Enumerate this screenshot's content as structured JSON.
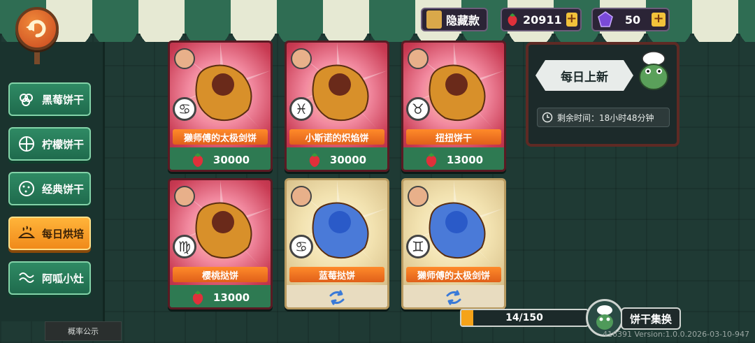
{
  "currency": {
    "hidden_label": "隐藏款",
    "strawberry_amount": "20911",
    "gem_amount": "50"
  },
  "sidebar": {
    "items": [
      {
        "label": "黑莓饼干"
      },
      {
        "label": "柠檬饼干"
      },
      {
        "label": "经典饼干"
      },
      {
        "label": "每日烘培"
      },
      {
        "label": "阿呱小灶"
      }
    ],
    "prob_label": "概率公示"
  },
  "cards": [
    {
      "name": "獭师傅的太极剑饼",
      "price": "30000",
      "zodiac": "♋",
      "style": "red"
    },
    {
      "name": "小斯诺的炽焰饼",
      "price": "30000",
      "zodiac": "♓",
      "style": "red"
    },
    {
      "name": "扭扭饼干",
      "price": "13000",
      "zodiac": "♉",
      "style": "red"
    },
    {
      "name": "樱桃挞饼",
      "price": "13000",
      "zodiac": "♍",
      "style": "red"
    },
    {
      "name": "蓝莓挞饼",
      "price": "",
      "zodiac": "♋",
      "style": "gold"
    },
    {
      "name": "獭师傅的太极剑饼",
      "price": "",
      "zodiac": "♊",
      "style": "gold"
    }
  ],
  "daily": {
    "title": "每日上新",
    "timer": "剩余时间：18小时48分钟"
  },
  "progress": {
    "text": "14/150",
    "fraction": 0.0933
  },
  "collect_label": "饼干集换",
  "version": "416391 Version:1.0.0.2026-03-10-947"
}
